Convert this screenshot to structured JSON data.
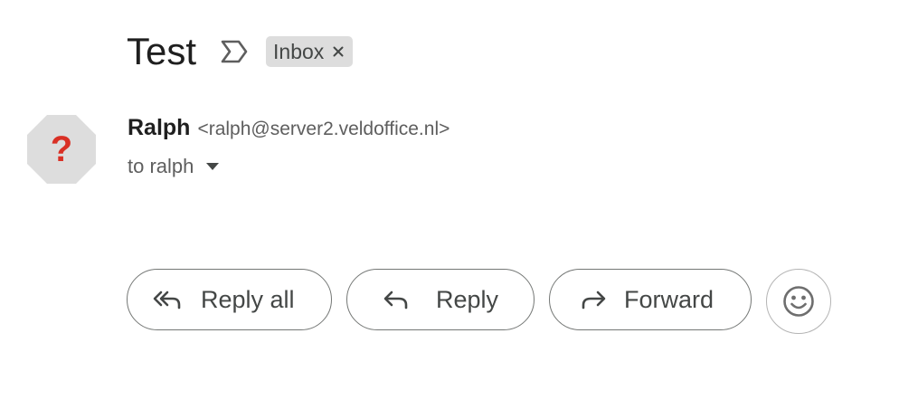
{
  "message": {
    "subject": "Test",
    "importance_icon": "label-important-outline-icon",
    "labels": [
      {
        "name": "Inbox",
        "remove_icon": "close-icon"
      }
    ]
  },
  "sender": {
    "avatar_icon": "unknown-sender-question-icon",
    "avatar_glyph": "?",
    "avatar_color": "#dddddd",
    "avatar_glyph_color": "#d93025",
    "name": "Ralph",
    "email": "<ralph@server2.veldoffice.nl>"
  },
  "recipient": {
    "text": "to ralph",
    "details_icon": "arrow-drop-down-icon"
  },
  "actions": {
    "reply_all": {
      "label": "Reply all",
      "icon": "reply-all-icon"
    },
    "reply": {
      "label": "Reply",
      "icon": "reply-icon"
    },
    "forward": {
      "label": "Forward",
      "icon": "forward-icon"
    },
    "emoji": {
      "icon": "emoji-smile-icon"
    }
  },
  "colors": {
    "text_primary": "#1f1f1f",
    "text_secondary": "#444746",
    "button_border": "#747775",
    "chip_background": "#dddddd"
  }
}
